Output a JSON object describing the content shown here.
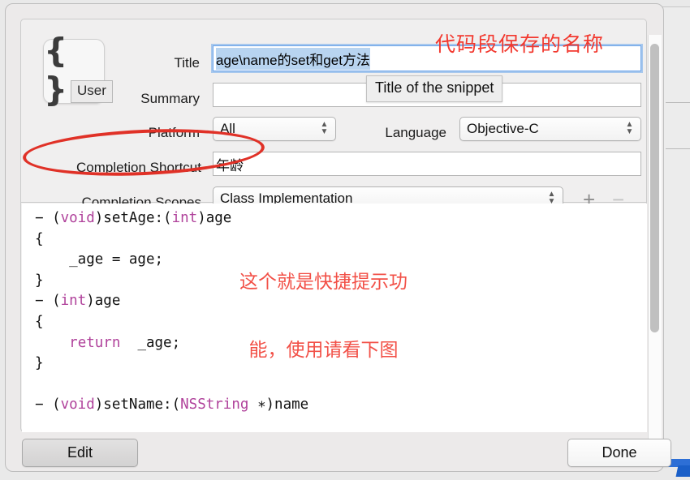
{
  "icon": {
    "glyph": "{ }",
    "badge_label": "User",
    "name": "snippet-braces-icon"
  },
  "form": {
    "title_label": "Title",
    "title_value": "age\\name的set和get方法",
    "summary_label": "Summary",
    "summary_value": "",
    "platform_label": "Platform",
    "platform_value": "All",
    "language_label": "Language",
    "language_value": "Objective-C",
    "shortcut_label": "Completion Shortcut",
    "shortcut_value": "年龄",
    "scopes_label": "Completion Scopes",
    "scopes_value": "Class Implementation",
    "add_scope_label": "+",
    "remove_scope_label": "−"
  },
  "tooltip": {
    "text": "Title of the snippet"
  },
  "code": {
    "lines": [
      [
        {
          "t": "− (",
          "c": "plain"
        },
        {
          "t": "void",
          "c": "kw"
        },
        {
          "t": ")setAge:(",
          "c": "plain"
        },
        {
          "t": "int",
          "c": "kw"
        },
        {
          "t": ")age",
          "c": "plain"
        }
      ],
      [
        {
          "t": "{",
          "c": "plain"
        }
      ],
      [
        {
          "t": "    _age = age;",
          "c": "plain"
        }
      ],
      [
        {
          "t": "}",
          "c": "plain"
        }
      ],
      [
        {
          "t": "− (",
          "c": "plain"
        },
        {
          "t": "int",
          "c": "kw"
        },
        {
          "t": ")age",
          "c": "plain"
        }
      ],
      [
        {
          "t": "{",
          "c": "plain"
        }
      ],
      [
        {
          "t": "    ",
          "c": "plain"
        },
        {
          "t": "return",
          "c": "kw"
        },
        {
          "t": "  _age;",
          "c": "plain"
        }
      ],
      [
        {
          "t": "}",
          "c": "plain"
        }
      ],
      [
        {
          "t": "",
          "c": "plain"
        }
      ],
      [
        {
          "t": "− (",
          "c": "plain"
        },
        {
          "t": "void",
          "c": "kw"
        },
        {
          "t": ")setName:(",
          "c": "plain"
        },
        {
          "t": "NSString",
          "c": "kw"
        },
        {
          "t": " ∗)name",
          "c": "plain"
        }
      ]
    ]
  },
  "footer": {
    "edit_label": "Edit",
    "done_label": "Done"
  },
  "annotations": {
    "title_note": "代码段保存的名称",
    "code_note_line1": "这个就是快捷提示功",
    "code_note_line2": "能，使用请看下图"
  },
  "colors": {
    "annotation_red": "#f2392f",
    "keyword_magenta": "#b0429b",
    "focus_blue": "#6aa2e8",
    "selection_blue": "#b8d4f0"
  }
}
